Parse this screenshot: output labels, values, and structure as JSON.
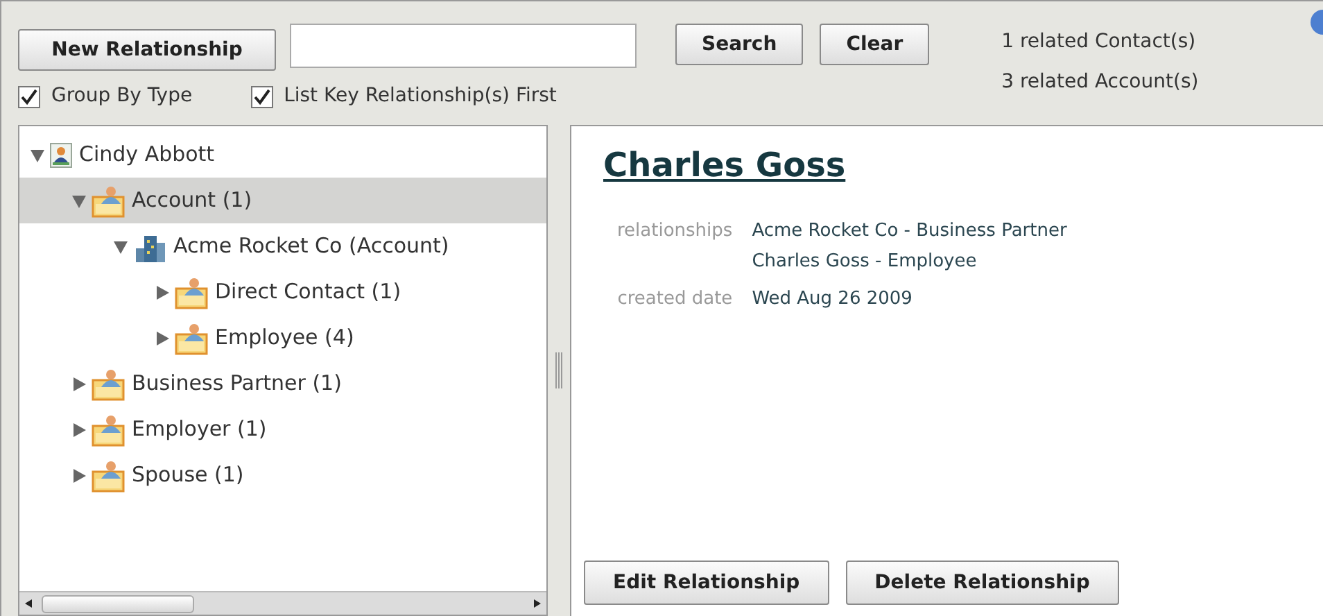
{
  "toolbar": {
    "new_button": "New Relationship",
    "search_button": "Search",
    "clear_button": "Clear",
    "checkboxes": [
      {
        "label": "Group By Type",
        "checked": true
      },
      {
        "label": "List Key Relationship(s) First",
        "checked": true
      }
    ],
    "counts": [
      "1 related Contact(s)",
      "3 related Account(s)"
    ]
  },
  "tree": [
    {
      "label": "Cindy Abbott",
      "kind": "person",
      "expanded": true,
      "selected": false,
      "children": [
        {
          "label": "Account (1)",
          "kind": "folder",
          "expanded": true,
          "selected": true,
          "children": [
            {
              "label": "Acme Rocket Co (Account)",
              "kind": "account",
              "expanded": true,
              "selected": false,
              "children": [
                {
                  "label": "Direct Contact (1)",
                  "kind": "folder",
                  "expanded": false,
                  "selected": false
                },
                {
                  "label": "Employee (4)",
                  "kind": "folder",
                  "expanded": false,
                  "selected": false
                }
              ]
            }
          ]
        },
        {
          "label": "Business Partner (1)",
          "kind": "folder",
          "expanded": false,
          "selected": false
        },
        {
          "label": "Employer (1)",
          "kind": "folder",
          "expanded": false,
          "selected": false
        },
        {
          "label": "Spouse (1)",
          "kind": "folder",
          "expanded": false,
          "selected": false
        }
      ]
    }
  ],
  "detail": {
    "title": "Charles Goss",
    "fields": [
      {
        "label": "relationships",
        "values": [
          "Acme Rocket Co - Business Partner",
          "Charles Goss - Employee"
        ]
      },
      {
        "label": "created date",
        "values": [
          "Wed Aug 26 2009"
        ]
      }
    ],
    "buttons": [
      "Edit Relationship",
      "Delete Relationship"
    ]
  }
}
